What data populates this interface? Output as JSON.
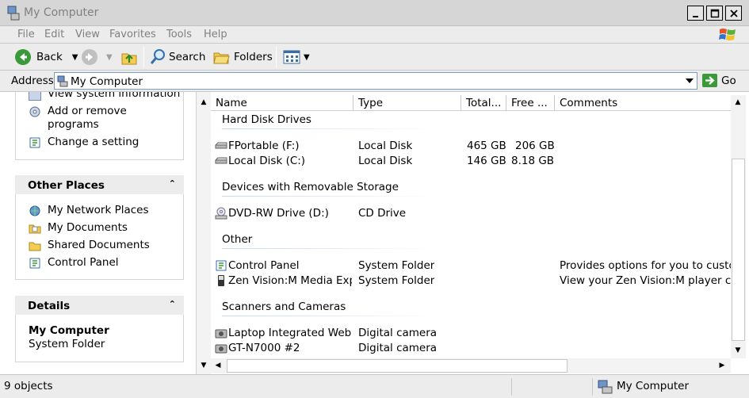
{
  "window": {
    "title": "My Computer"
  },
  "menu": [
    "File",
    "Edit",
    "View",
    "Favorites",
    "Tools",
    "Help"
  ],
  "toolbar": {
    "back_label": "Back",
    "search_label": "Search",
    "folders_label": "Folders"
  },
  "address": {
    "label": "Address",
    "value": "My Computer",
    "go_label": "Go"
  },
  "tasks": {
    "partial": "View system information",
    "add_remove_1": "Add or remove",
    "add_remove_2": "programs",
    "change_setting": "Change a setting"
  },
  "other_places": {
    "title": "Other Places",
    "items": [
      "My Network Places",
      "My Documents",
      "Shared Documents",
      "Control Panel"
    ]
  },
  "details": {
    "title": "Details",
    "name": "My Computer",
    "type": "System Folder"
  },
  "columns": [
    "Name",
    "Type",
    "Total...",
    "Free ...",
    "Comments"
  ],
  "groups": {
    "hdd": {
      "title": "Hard Disk Drives",
      "rows": [
        {
          "name": "FPortable (F:)",
          "type": "Local Disk",
          "total": "465 GB",
          "free": "206 GB",
          "comments": ""
        },
        {
          "name": "Local Disk (C:)",
          "type": "Local Disk",
          "total": "146 GB",
          "free": "8.18 GB",
          "comments": ""
        }
      ]
    },
    "removable": {
      "title": "Devices with Removable Storage",
      "rows": [
        {
          "name": "DVD-RW Drive (D:)",
          "type": "CD Drive",
          "total": "",
          "free": "",
          "comments": ""
        }
      ]
    },
    "other": {
      "title": "Other",
      "rows": [
        {
          "name": "Control Panel",
          "type": "System Folder",
          "total": "",
          "free": "",
          "comments": "Provides options for you to custom"
        },
        {
          "name": "Zen Vision:M Media Expl...",
          "type": "System Folder",
          "total": "",
          "free": "",
          "comments": "View your Zen Vision:M player conn"
        }
      ]
    },
    "scanners": {
      "title": "Scanners and Cameras",
      "rows": [
        {
          "name": "Laptop Integrated Web...",
          "type": "Digital camera",
          "total": "",
          "free": "",
          "comments": ""
        },
        {
          "name": "GT-N7000 #2",
          "type": "Digital camera",
          "total": "",
          "free": "",
          "comments": ""
        }
      ]
    }
  },
  "status": {
    "count": "9 objects",
    "location": "My Computer"
  }
}
